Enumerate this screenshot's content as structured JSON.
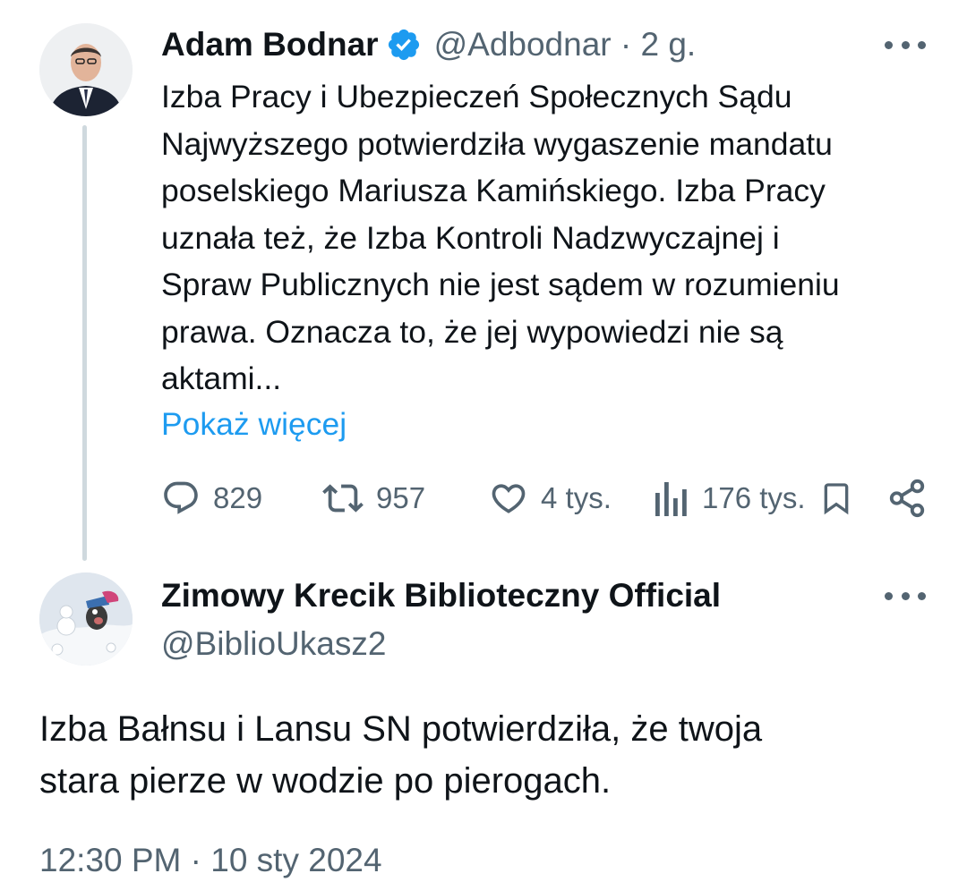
{
  "tweet1": {
    "author_name": "Adam Bodnar",
    "handle_time": "@Adbodnar · 2 g.",
    "text": "Izba Pracy i Ubezpieczeń Społecznych Sądu\nNajwyższego potwierdziła wygaszenie mandatu\nposelskiego Mariusza Kamińskiego. Izba Pracy\nuznała też, że Izba Kontroli Nadzwyczajnej i\nSpraw Publicznych nie jest sądem w rozumieniu\nprawa. Oznacza to, że jej wypowiedzi nie są\naktami...",
    "show_more": "Pokaż więcej",
    "replies": "829",
    "retweets": "957",
    "likes": "4 tys.",
    "views": "176 tys.",
    "icons": [
      "verified-badge-icon",
      "more-icon",
      "reply-icon",
      "retweet-icon",
      "like-icon",
      "views-icon",
      "bookmark-icon",
      "share-icon"
    ]
  },
  "tweet2": {
    "author_name": "Zimowy Krecik Biblioteczny Official",
    "handle": "@BiblioUkasz2",
    "text": "Izba Bałnsu i Lansu SN potwierdziła, że twoja\nstara pierze w wodzie po pierogach.",
    "timestamp_partial": "12:30 PM · 10 sty 2024"
  },
  "colors": {
    "text": "#0f1419",
    "secondary": "#536471",
    "accent": "#1d9bf0",
    "thread_line": "#cfd9de"
  }
}
